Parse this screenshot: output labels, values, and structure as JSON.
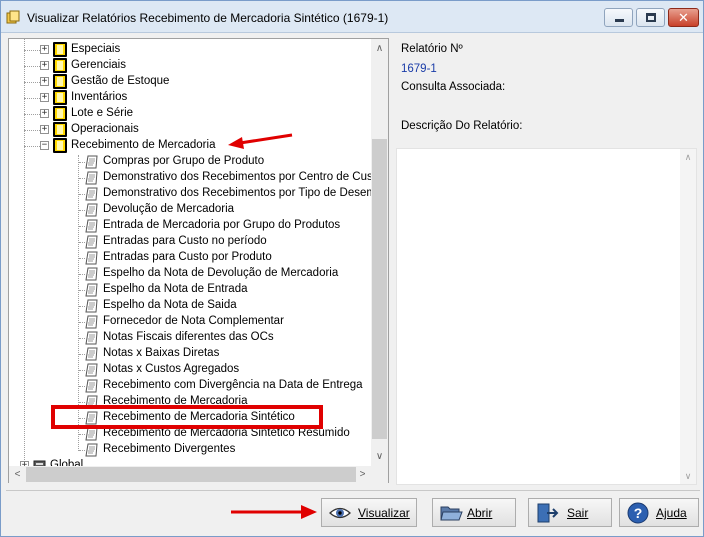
{
  "window": {
    "title": "Visualizar Relatórios Recebimento de Mercadoria Sintético (1679-1)",
    "controls": {
      "minimize": "—",
      "maximize": "☐",
      "close": "✕"
    }
  },
  "tree": {
    "folders": [
      {
        "label": "Especiais",
        "state": "+"
      },
      {
        "label": "Gerenciais",
        "state": "+"
      },
      {
        "label": "Gestão de Estoque",
        "state": "+"
      },
      {
        "label": "Inventários",
        "state": "+"
      },
      {
        "label": "Lote e Série",
        "state": "+"
      },
      {
        "label": "Operacionais",
        "state": "+"
      },
      {
        "label": "Recebimento de Mercadoria",
        "state": "−"
      }
    ],
    "reports": [
      "Compras por Grupo de Produto",
      "Demonstrativo dos Recebimentos por Centro de Custo",
      "Demonstrativo dos Recebimentos por Tipo de Desembolso",
      "Devolução de Mercadoria",
      "Entrada de Mercadoria por Grupo do Produtos",
      "Entradas para Custo no período",
      "Entradas para Custo por Produto",
      "Espelho da Nota de Devolução de Mercadoria",
      "Espelho da Nota de Entrada",
      "Espelho da Nota de Saida",
      "Fornecedor de Nota Complementar",
      "Notas Fiscais diferentes das OCs",
      "Notas x Baixas Diretas",
      "Notas x Custos Agregados",
      "Recebimento com Divergência na Data de Entrega",
      "Recebimento de Mercadoria",
      "Recebimento de Mercadoria Sintético",
      "Recebimento de Mercadoria Sintético Resumido",
      "Recebimento Divergentes"
    ],
    "root_item": {
      "label": "Global",
      "state": "+"
    },
    "scroll_arrows": {
      "up": "∧",
      "down": "∨",
      "left": "<",
      "right": ">"
    }
  },
  "info": {
    "report_number_label": "Relatório Nº",
    "report_number_value": "1679-1",
    "query_label": "Consulta Associada:",
    "description_label": "Descrição Do Relatório:"
  },
  "buttons": {
    "view": "Visualizar",
    "open": "Abrir",
    "exit": "Sair",
    "help": "Ajuda"
  },
  "colors": {
    "highlight_box": "#e00000",
    "arrow": "#e00000",
    "value_text": "#1a3ca8"
  }
}
